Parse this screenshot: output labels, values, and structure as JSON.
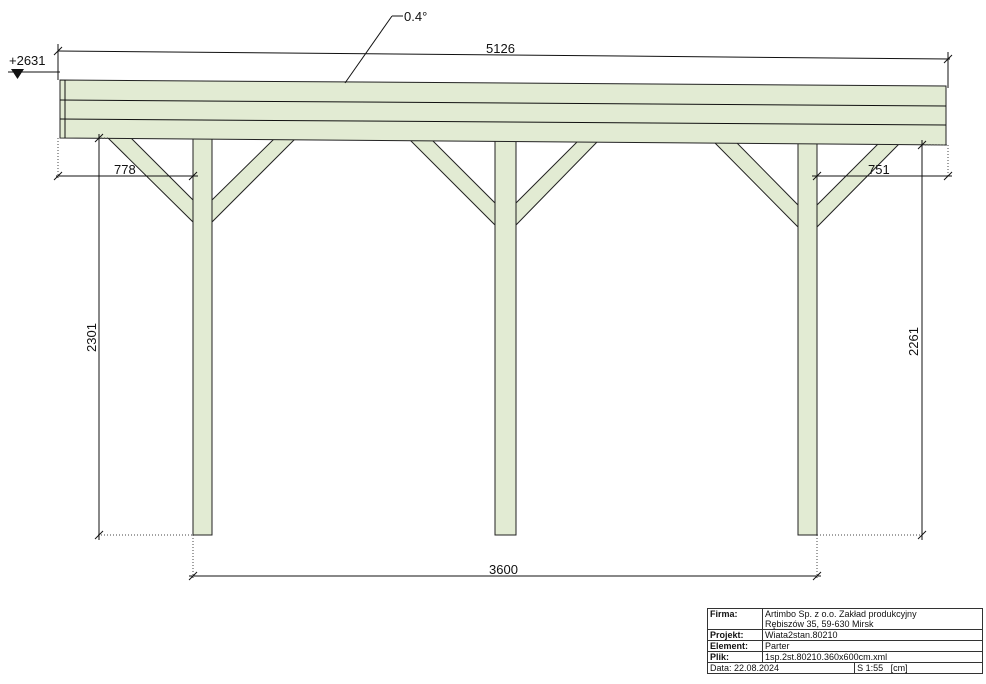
{
  "dimensions": {
    "slope": "0.4°",
    "elevation": "+2631",
    "total_length": "5126",
    "left_overhang": "778",
    "right_overhang": "751",
    "left_height": "2301",
    "right_height": "2261",
    "post_span": "3600"
  },
  "title_block": {
    "firma_label": "Firma:",
    "firma_line1": "Artimbo Sp. z o.o. Zakład produkcyjny",
    "firma_line2": "Rębiszów 35, 59-630 Mirsk",
    "projekt_label": "Projekt:",
    "projekt_value": "Wiata2stan.80210",
    "element_label": "Element:",
    "element_value": "Parter",
    "plik_label": "Plik:",
    "plik_value": "1sp.2st.80210.360x600cm.xml",
    "data_value": "Data: 22.08.2024",
    "scale_value": "S 1:55",
    "unit_value": "[cm]"
  },
  "colors": {
    "wood": "#e2ebd3",
    "line": "#222222"
  }
}
